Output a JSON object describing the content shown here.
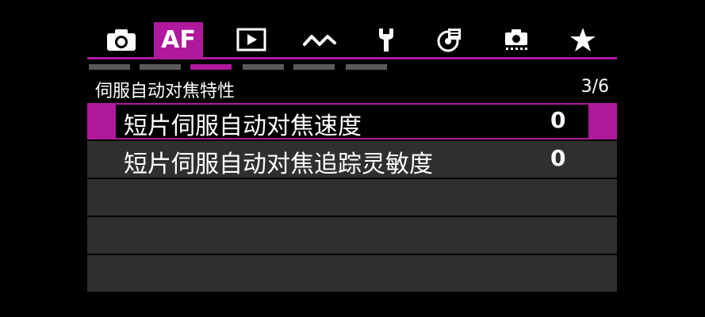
{
  "tabs": [
    {
      "id": "camera",
      "icon": "camera-icon"
    },
    {
      "id": "af",
      "label": "AF",
      "active": true
    },
    {
      "id": "playback",
      "icon": "play-icon"
    },
    {
      "id": "network",
      "icon": "wave-icon"
    },
    {
      "id": "setup",
      "icon": "wrench-icon"
    },
    {
      "id": "assist",
      "icon": "assist-icon"
    },
    {
      "id": "custom",
      "icon": "custom-camera-icon"
    },
    {
      "id": "mymenu",
      "icon": "star-icon"
    }
  ],
  "pages": {
    "count": 6,
    "active_index": 2
  },
  "header": {
    "title": "伺服自动对焦特性",
    "page": "3/6"
  },
  "items": [
    {
      "label": "短片伺服自动对焦速度",
      "value": "0",
      "selected": true
    },
    {
      "label": "短片伺服自动对焦追踪灵敏度",
      "value": "0",
      "selected": false
    },
    {
      "label": "",
      "value": ""
    },
    {
      "label": "",
      "value": ""
    },
    {
      "label": "",
      "value": ""
    }
  ],
  "colors": {
    "accent": "#b0199b",
    "row_bg": "#2f2f2f",
    "page_inactive": "#5a5a5a"
  }
}
